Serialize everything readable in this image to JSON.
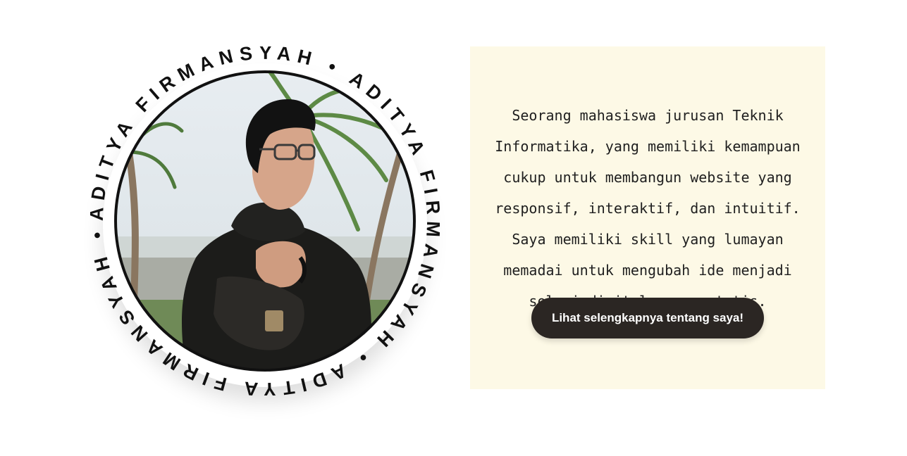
{
  "profile": {
    "ring_text": "ADITYA FIRMANSYAH • ADITYA FIRMANSYAH • ADITYA FIRMANSYAH • ",
    "photo_icon": "portrait-photo"
  },
  "about": {
    "description": "Seorang mahasiswa jurusan Teknik Informatika, yang memiliki kemampuan cukup untuk membangun website yang responsif, interaktif, dan intuitif. Saya memiliki skill yang lumayan memadai untuk mengubah ide menjadi solusi digital yang estetis.",
    "button_label": "Lihat selengkapnya tentang saya!"
  },
  "colors": {
    "card_background": "#fdf9e6",
    "button_background": "#2b2623",
    "ring_text": "#111111"
  }
}
